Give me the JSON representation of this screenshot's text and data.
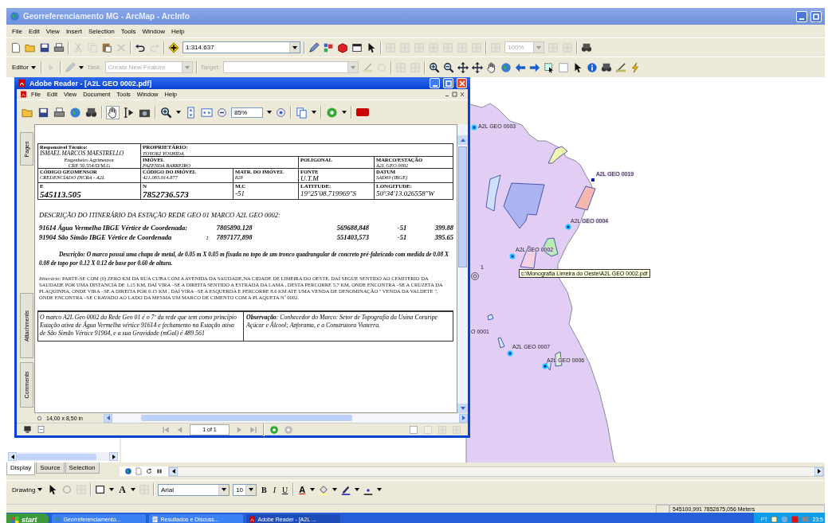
{
  "window": {
    "title": "Georreferenciamento MG - ArcMap - ArcInfo"
  },
  "menu": [
    "File",
    "Edit",
    "View",
    "Insert",
    "Selection",
    "Tools",
    "Window",
    "Help"
  ],
  "standard_toolbar": {
    "scale": "1:314.637",
    "layout_zoom": "100%"
  },
  "editor_toolbar": {
    "editor": "Editor",
    "task_label": "Task:",
    "task": "Create New Feature",
    "target_label": "Target:",
    "disabled": true
  },
  "reader": {
    "title": "Adobe Reader - [A2L GEO 0002.pdf]",
    "menu": [
      "File",
      "Edit",
      "View",
      "Document",
      "Tools",
      "Window",
      "Help"
    ],
    "zoom": "85%",
    "side_tabs": [
      "Pages",
      "Attachments",
      "Comments"
    ],
    "document": {
      "technician": {
        "label": "Responsável Técnico:",
        "name": "ISMAEL MARCOS MAESTRELLO",
        "title": "Engenheiro Agrimensor",
        "registry": "CRE 50.554/D/M.G"
      },
      "owner": {
        "label": "PROPRIETÁRIO:",
        "value": "TOYOKI YOSHIDA"
      },
      "rows": [
        [
          "",
          {
            "label": "IMÓVEL",
            "value": "FAZENDA BARREIRO"
          },
          "",
          {
            "label": "POLIGONAL"
          },
          {
            "label": "MARCO/ESTAÇÃO",
            "value": "A2L GEO 0002"
          }
        ],
        [
          {
            "label": "CÓDIGO GEOMENSOR",
            "value": "CREDENCIADO INCRA - A2L"
          },
          {
            "label": "CÓDIGO DO IMÓVEL",
            "value": "421.065.014.877"
          },
          {
            "label": "MATR. DO IMÓVEL",
            "value": "828"
          },
          {
            "label": "FONTE",
            "value": "U.T.M"
          },
          {
            "label": "DATUM",
            "value": "SAD69 (IBGE)"
          }
        ],
        [
          {
            "label": "E",
            "value": "545113.505"
          },
          {
            "label": "N",
            "value": "7852736.573"
          },
          {
            "label": "M.C",
            "value": "-51"
          },
          {
            "label": "LATITUDE:",
            "value": "19°25'08.719969\"S"
          },
          {
            "label": "LONGITUDE:",
            "value": "50°34'13.026558\"W"
          }
        ]
      ],
      "heading": "DESCRIÇÃO DO ITINERÁRIO DA ESTAÇÃO REDE GEO 01 MARCO A2L GEO 0002:",
      "vertices": [
        {
          "name": "91614 Água Vermelha IBGE Vértice de Coordenada:",
          "north": "7805890.128",
          "east": "569688,848",
          "mc": "-51",
          "altitude": "399.88"
        },
        {
          "name": "91904 São Simão IBGE Vértice de Coordenada",
          "separator": ":",
          "north": "7897177,898",
          "east": "551403,573",
          "mc": "-51",
          "altitude": "395.65"
        }
      ],
      "description": "Descrição: O marco possui uma chapa de metal, de 0.05 m X 0.05 m fixada no topo de um tronco quadrangular de concreto pré-fabricado com medida de 0.08 X 0.08 de topo por 0.12 X 0.12 de base por 0.60 de altura.",
      "itinerary": "*Itinerário:*          PARTE-SE COM (0) ZERO KM DA RUA CUBA COM A AVENIDA DA SAUDADE,NA CIDADE DE LIMEIRA DO OESTE,  DAÍ SEGUE SENTIDO AO CEMITERIO DA SAUDADE POR UMA DISTANCIA DE 1.15 KM, DAÍ VIRA –SE A DIREITA SENTIDO A ESTRADA DA  LAMA , DESTA PERCORRE 5.7 KM, ONDE ENCONTRA –SE A CRUZETA DA PLAQUINHA, ONDE  VIRA –SE A DIREITA POR 0.15 KM , DAÍ VIRA –SE A ESQUERDA E PERCORRE 8.6 KM ATE UMA VENDA DE DENOMINAÇÃO \" VENDA DA VALDETE \", ONDE ENCONTRA –SE  CRAVADO AO LADO DA MESMA UM MARCO DE CIMENTO COM A PLAQUETA Nº 0002.",
      "note": "O marco A2L Geo 0002 da Rede Geo 01 é o 7º da rede que tem como princípio Estação ativa de Água Vermelha vértice 91614 e fechamento na Estação ativa de São Simão Vértice 91904, e a sua Gravidade (mGal) é 489.561",
      "observation": "**Observação**: Conhecedor do Marco: Setor de Topografia da Usina Coruripe Açúcar e Álcool; Azforama, e a Construtora Viaterra."
    },
    "page_size": "14,00 x 8,50 in",
    "page": "1 of 1"
  },
  "map": {
    "labels": [
      {
        "text": "A2L GEO 0003",
        "kind": "dot"
      },
      {
        "text": "A2L GEO 0019",
        "kind": "square"
      },
      {
        "text": "A2L GEO 0004",
        "kind": "dot"
      },
      {
        "text": "A2L GEO 0002",
        "kind": "dot"
      },
      {
        "text": "1",
        "kind": "ring"
      },
      {
        "text": "O 0001",
        "kind": "plain"
      },
      {
        "text": "A2L GEO 0007",
        "kind": "dot"
      },
      {
        "text": "A2L GEO 0006",
        "kind": "dot"
      }
    ],
    "tooltip": "c:\\Monografia Limeira do Oeste\\A2L GEO 0002.pdf"
  },
  "toc_tabs": [
    {
      "label": "Display",
      "selected": true
    },
    {
      "label": "Source",
      "selected": false
    },
    {
      "label": "Selection",
      "selected": false
    }
  ],
  "drawing_toolbar": {
    "menu": "Drawing",
    "text_tool": "A",
    "font": "Arial",
    "size": "10",
    "bold": "B",
    "italic": "I",
    "underline": "U",
    "font_color": "A"
  },
  "status_bar": {
    "coordinates": "545100,991  7852675,056 Meters"
  },
  "taskbar": {
    "start": "start",
    "items": [
      {
        "label": "Georreferenciamento...",
        "selected": false
      },
      {
        "label": "Resultados e Discuss...",
        "selected": false
      },
      {
        "label": "Adobe Reader - [A2L ...",
        "selected": true
      }
    ],
    "language": "PT",
    "clock": "23:5"
  }
}
